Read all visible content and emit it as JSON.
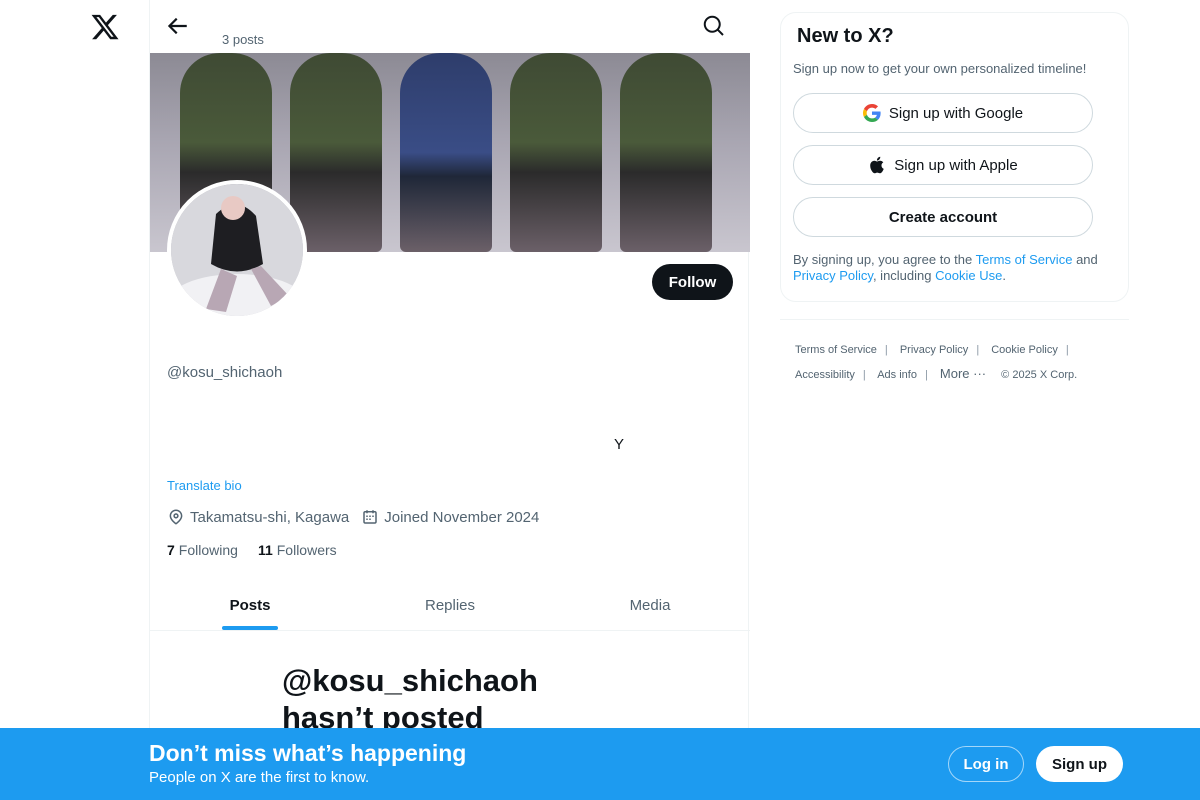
{
  "header": {
    "post_count": "3 posts"
  },
  "profile": {
    "handle": "@kosu_shichaoh",
    "bio_text": "Y",
    "translate_label": "Translate bio",
    "location": "Takamatsu-shi, Kagawa",
    "joined": "Joined November 2024",
    "following_count": "7",
    "following_label": "Following",
    "followers_count": "11",
    "followers_label": "Followers",
    "follow_label": "Follow"
  },
  "tabs": [
    {
      "label": "Posts",
      "active": true
    },
    {
      "label": "Replies",
      "active": false
    },
    {
      "label": "Media",
      "active": false
    }
  ],
  "empty_state": {
    "title": "@kosu_shichaoh hasn’t posted"
  },
  "signup_box": {
    "title": "New to X?",
    "subtitle": "Sign up now to get your own personalized timeline!",
    "google_label": "Sign up with Google",
    "apple_label": "Sign up with Apple",
    "create_label": "Create account",
    "legal_prefix": "By signing up, you agree to the",
    "terms_link": "Terms of Service",
    "legal_and": "and",
    "privacy_link": "Privacy Policy",
    "legal_including": ", including",
    "cookie_link": "Cookie Use",
    "legal_end": "."
  },
  "footer": {
    "terms": "Terms of Service",
    "privacy": "Privacy Policy",
    "cookie": "Cookie Policy",
    "accessibility": "Accessibility",
    "ads": "Ads info",
    "more": "More ···",
    "copyright": "© 2025 X Corp."
  },
  "bottom_bar": {
    "title": "Don’t miss what’s happening",
    "subtitle": "People on X are the first to know.",
    "login_label": "Log in",
    "signup_label": "Sign up"
  },
  "colors": {
    "accent": "#1d9bf0",
    "text_primary": "#0f1419",
    "text_secondary": "#536471",
    "border": "#eff3f4"
  },
  "icons": [
    "x-logo-icon",
    "back-arrow-icon",
    "search-icon",
    "location-icon",
    "calendar-icon",
    "google-icon",
    "apple-icon"
  ]
}
